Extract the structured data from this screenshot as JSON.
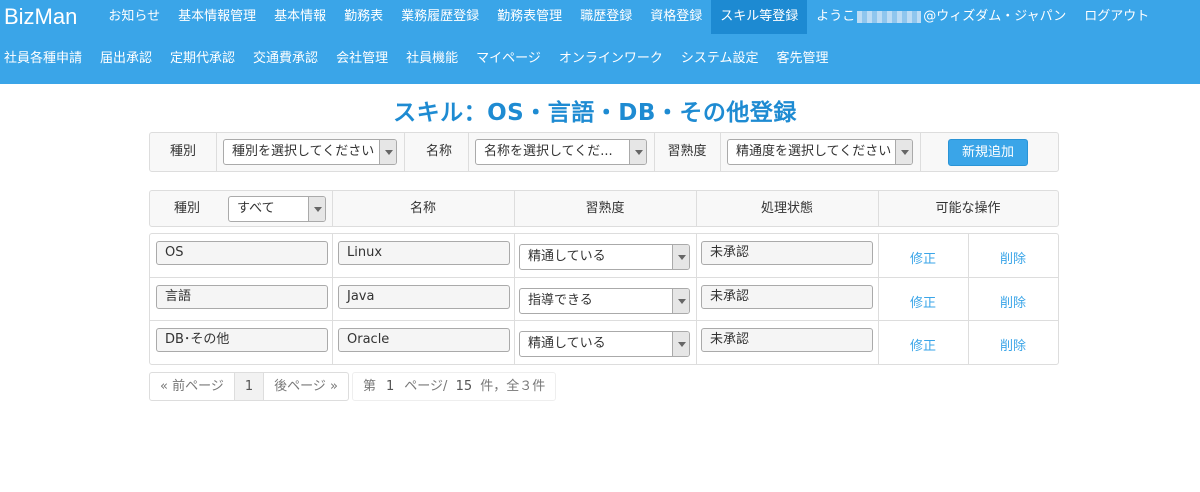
{
  "nav": {
    "brand": "BizMan",
    "row1": [
      {
        "id": "news",
        "label": "お知らせ",
        "active": false
      },
      {
        "id": "basic-mgmt",
        "label": "基本情報管理",
        "active": false
      },
      {
        "id": "basic-info",
        "label": "基本情報",
        "active": false
      },
      {
        "id": "attendance",
        "label": "勤務表",
        "active": false
      },
      {
        "id": "work-history",
        "label": "業務履歴登録",
        "active": false
      },
      {
        "id": "attendance-mgmt",
        "label": "勤務表管理",
        "active": false
      },
      {
        "id": "career",
        "label": "職歴登録",
        "active": false
      },
      {
        "id": "qualification",
        "label": "資格登録",
        "active": true
      },
      {
        "id": "skill",
        "label": "スキル等登録",
        "active": true
      }
    ],
    "user_prefix": "ようこ",
    "user_suffix": "@ウィズダム・ジャパン",
    "logout": "ログアウト",
    "row2": [
      {
        "id": "employee-requests",
        "label": "社員各種申請"
      },
      {
        "id": "notification-approval",
        "label": "届出承認"
      },
      {
        "id": "commuter-approval",
        "label": "定期代承認"
      },
      {
        "id": "transport-approval",
        "label": "交通費承認"
      },
      {
        "id": "company-mgmt",
        "label": "会社管理"
      },
      {
        "id": "employee-functions",
        "label": "社員機能"
      },
      {
        "id": "mypage",
        "label": "マイページ"
      },
      {
        "id": "online-work",
        "label": "オンラインワーク"
      },
      {
        "id": "system-settings",
        "label": "システム設定"
      },
      {
        "id": "client-mgmt",
        "label": "客先管理"
      }
    ]
  },
  "page_title": "スキル：OS・言語・DB・その他登録",
  "filter": {
    "type_label": "種別",
    "type_placeholder": "種別を選択してください",
    "name_label": "名称",
    "name_placeholder": "名称を選択してくだ...",
    "level_label": "習熟度",
    "level_placeholder": "精通度を選択してください",
    "add_button": "新規追加"
  },
  "table": {
    "headers": {
      "type": "種別",
      "type_filter_value": "すべて",
      "name": "名称",
      "level": "習熟度",
      "status": "処理状態",
      "actions": "可能な操作"
    },
    "rows": [
      {
        "type": "OS",
        "name": "Linux",
        "level": "精通している",
        "status": "未承認",
        "edit": "修正",
        "delete": "削除"
      },
      {
        "type": "言語",
        "name": "Java",
        "level": "指導できる",
        "status": "未承認",
        "edit": "修正",
        "delete": "削除"
      },
      {
        "type": "DB･その他",
        "name": "Oracle",
        "level": "精通している",
        "status": "未承認",
        "edit": "修正",
        "delete": "削除"
      }
    ]
  },
  "pager": {
    "prev": "« 前ページ",
    "current": "1",
    "next": "後ページ »",
    "info_page_prefix": "第",
    "info_page": "1",
    "info_page_mid": "ページ/",
    "info_total_pages": "15",
    "info_suffix": "件，全３件"
  },
  "colors": {
    "nav_bg": "#3aa5e8",
    "nav_active": "#1d8ad2",
    "title": "#1e8bd2",
    "link": "#3aa5e8"
  }
}
